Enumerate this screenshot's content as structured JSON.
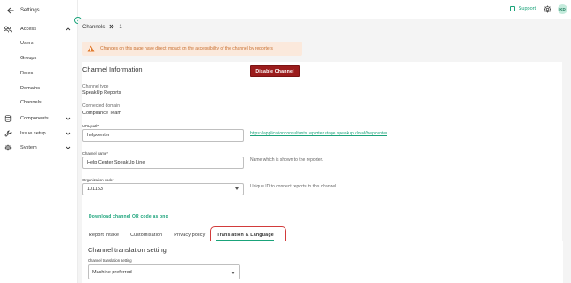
{
  "sidebar": {
    "title": "Settings",
    "sections": [
      {
        "label": "Access",
        "icon": "users-icon",
        "expanded": true
      },
      {
        "label": "Components",
        "icon": "database-icon",
        "expanded": false
      },
      {
        "label": "Issue setup",
        "icon": "wrench-icon",
        "expanded": false
      },
      {
        "label": "System",
        "icon": "gear-icon",
        "expanded": false
      }
    ],
    "access_items": [
      "Users",
      "Groups",
      "Roles",
      "Domains",
      "Channels"
    ]
  },
  "topbar": {
    "support_label": "Support",
    "avatar_initials": "KD"
  },
  "breadcrumb": {
    "root": "Channels",
    "current": "1"
  },
  "warning_text": "Changes on this page have direct impact on the accessibility of the channel by reporters",
  "channel_info": {
    "heading": "Channel Information",
    "disable_button": "Disable Channel",
    "type_label": "Channel type",
    "type_value": "SpeakUp Reports",
    "domain_label": "Connected domain",
    "domain_value": "Compliance Team",
    "url_path_label": "URL path*",
    "url_path_value": "helpcenter",
    "url_link": "https://applicationconsultants.reporter.stage.speakup.cloud/helpcenter",
    "channel_name_label": "Channel name*",
    "channel_name_value": "Help Center SpeakUp Line",
    "channel_name_help": "Name which is shown to the reporter.",
    "org_code_label": "Organization code*",
    "org_code_value": "101153",
    "org_code_help": "Unique ID to connect reports to this channel.",
    "qr_link": "Download channel QR code as png"
  },
  "tabs": [
    {
      "label": "Report intake",
      "active": false
    },
    {
      "label": "Customisation",
      "active": false
    },
    {
      "label": "Privacy policy",
      "active": false
    },
    {
      "label": "Translation & Language",
      "active": true
    }
  ],
  "translation": {
    "heading": "Channel translation setting",
    "setting_label": "Channel translation setting",
    "setting_value": "Machine preferred"
  },
  "colors": {
    "accent": "#1aa37a",
    "danger": "#9b1c1c",
    "warning_bg": "#fbe9dc",
    "warning_text": "#c86f2f",
    "highlight": "#d23b3b"
  }
}
